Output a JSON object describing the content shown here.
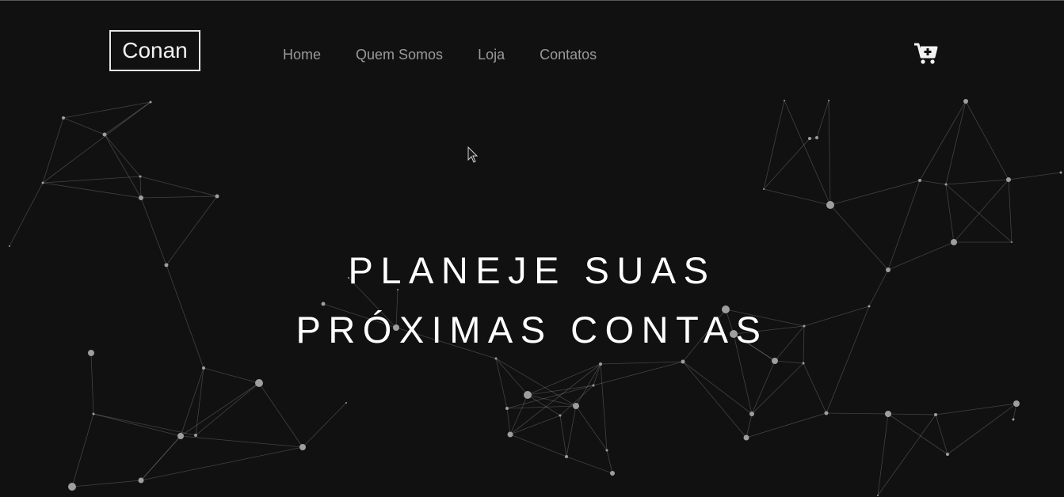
{
  "brand": {
    "logo_text": "Conan"
  },
  "nav": {
    "items": [
      {
        "label": "Home"
      },
      {
        "label": "Quem Somos"
      },
      {
        "label": "Loja"
      },
      {
        "label": "Contatos"
      }
    ]
  },
  "cart": {
    "icon": "cart-plus-icon"
  },
  "hero": {
    "line1": "PLANEJE SUAS",
    "line2": "PRÓXIMAS CONTAS"
  },
  "colors": {
    "background": "#111111",
    "nav_text": "#9a9a9a",
    "logo_border": "#e6e6e6",
    "hero_text": "#ffffff",
    "network": "#9e9e9e"
  }
}
